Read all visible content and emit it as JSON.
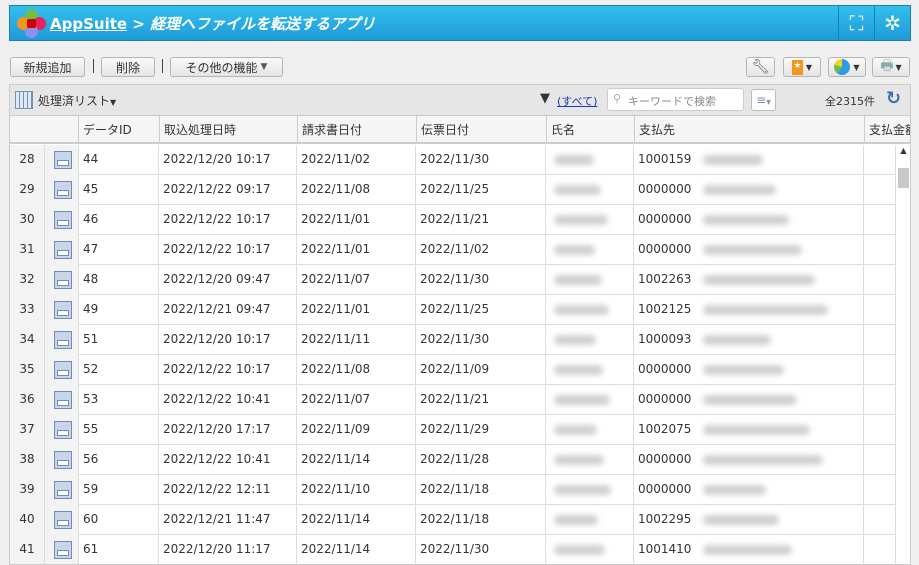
{
  "header": {
    "app": "AppSuite",
    "separator": ">",
    "title": "経理へファイルを転送するアプリ"
  },
  "toolbar": {
    "add": "新規追加",
    "delete": "削除",
    "more": "その他の機能"
  },
  "listbar": {
    "view": "処理済リスト",
    "filter": "(すべて)",
    "search_placeholder": "キーワードで検索",
    "count": "全2315件"
  },
  "columns": [
    "データID",
    "取込処理日時",
    "請求書日付",
    "伝票日付",
    "氏名",
    "支払先",
    "支払金額"
  ],
  "rows": [
    {
      "n": "28",
      "id": "44",
      "dt": "2022/12/20 10:17",
      "inv": "2022/11/02",
      "slip": "2022/11/30",
      "payee": "1000159"
    },
    {
      "n": "29",
      "id": "45",
      "dt": "2022/12/22 09:17",
      "inv": "2022/11/08",
      "slip": "2022/11/25",
      "payee": "0000000"
    },
    {
      "n": "30",
      "id": "46",
      "dt": "2022/12/22 10:17",
      "inv": "2022/11/01",
      "slip": "2022/11/21",
      "payee": "0000000"
    },
    {
      "n": "31",
      "id": "47",
      "dt": "2022/12/22 10:17",
      "inv": "2022/11/01",
      "slip": "2022/11/02",
      "payee": "0000000"
    },
    {
      "n": "32",
      "id": "48",
      "dt": "2022/12/20 09:47",
      "inv": "2022/11/07",
      "slip": "2022/11/30",
      "payee": "1002263"
    },
    {
      "n": "33",
      "id": "49",
      "dt": "2022/12/21 09:47",
      "inv": "2022/11/01",
      "slip": "2022/11/25",
      "payee": "1002125"
    },
    {
      "n": "34",
      "id": "51",
      "dt": "2022/12/20 10:17",
      "inv": "2022/11/11",
      "slip": "2022/11/30",
      "payee": "1000093"
    },
    {
      "n": "35",
      "id": "52",
      "dt": "2022/12/22 10:17",
      "inv": "2022/11/08",
      "slip": "2022/11/09",
      "payee": "0000000"
    },
    {
      "n": "36",
      "id": "53",
      "dt": "2022/12/22 10:41",
      "inv": "2022/11/07",
      "slip": "2022/11/21",
      "payee": "0000000"
    },
    {
      "n": "37",
      "id": "55",
      "dt": "2022/12/20 17:17",
      "inv": "2022/11/09",
      "slip": "2022/11/29",
      "payee": "1002075"
    },
    {
      "n": "38",
      "id": "56",
      "dt": "2022/12/22 10:41",
      "inv": "2022/11/14",
      "slip": "2022/11/28",
      "payee": "0000000"
    },
    {
      "n": "39",
      "id": "59",
      "dt": "2022/12/22 12:11",
      "inv": "2022/11/10",
      "slip": "2022/11/18",
      "payee": "0000000"
    },
    {
      "n": "40",
      "id": "60",
      "dt": "2022/12/21 11:47",
      "inv": "2022/11/14",
      "slip": "2022/11/18",
      "payee": "1002295"
    },
    {
      "n": "41",
      "id": "61",
      "dt": "2022/12/20 11:17",
      "inv": "2022/11/14",
      "slip": "2022/11/30",
      "payee": "1001410"
    }
  ]
}
